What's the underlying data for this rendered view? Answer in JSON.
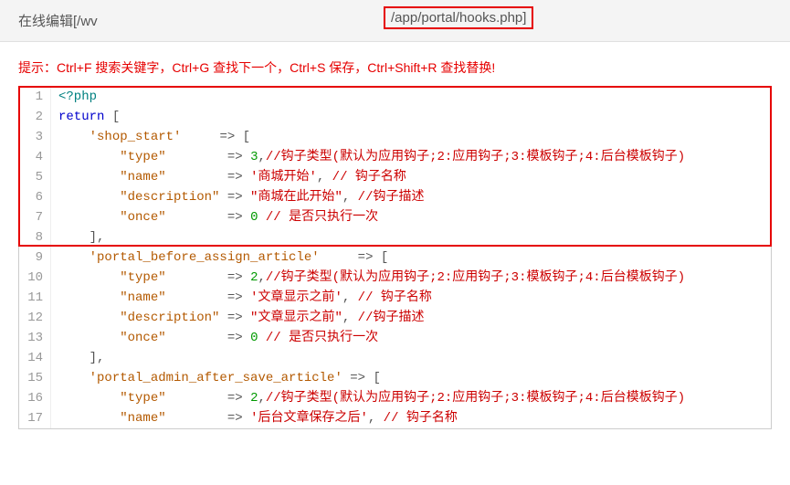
{
  "header": {
    "title_prefix": "在线编辑[/wv",
    "path_fragment": "/app/portal/hooks.php]"
  },
  "hint": "提示：Ctrl+F 搜索关键字，Ctrl+G 查找下一个，Ctrl+S 保存，Ctrl+Shift+R 查找替换!",
  "lines": {
    "l1_open": "<?php",
    "l2_return": "return",
    "l2_brkt": " [",
    "l3_key": "'shop_start'",
    "l3_arrow": "     => [",
    "l4_key": "\"type\"",
    "l4_arrow": "        => ",
    "l4_val": "3",
    "l4_com": ",",
    "l4_cmt1": "//钩子类型(默认为应用钩子;2:应用钩子;3:模板钩子;4:后台模板钩子)",
    "l5_key": "\"name\"",
    "l5_arrow": "        => ",
    "l5_val": "'商城开始'",
    "l5_com": ",",
    "l5_cmt": " // 钩子名称",
    "l6_key": "\"description\"",
    "l6_arrow": " => ",
    "l6_val": "\"商城在此开始\"",
    "l6_com": ",",
    "l6_cmt": " //钩子描述",
    "l7_key": "\"once\"",
    "l7_arrow": "        => ",
    "l7_val": "0",
    "l7_cmt": " // 是否只执行一次",
    "l8": "    ],",
    "l9_key": "'portal_before_assign_article'",
    "l9_arrow": "     => [",
    "l10_key": "\"type\"",
    "l10_arrow": "        => ",
    "l10_val": "2",
    "l10_com": ",",
    "l10_cmt1": "//钩子类型(默认为应用钩子;2:应用钩子;3:模板钩子;4:后台模板钩子)",
    "l11_key": "\"name\"",
    "l11_arrow": "        => ",
    "l11_val": "'文章显示之前'",
    "l11_com": ",",
    "l11_cmt": " // 钩子名称",
    "l12_key": "\"description\"",
    "l12_arrow": " => ",
    "l12_val": "\"文章显示之前\"",
    "l12_com": ",",
    "l12_cmt": " //钩子描述",
    "l13_key": "\"once\"",
    "l13_arrow": "        => ",
    "l13_val": "0",
    "l13_cmt": " // 是否只执行一次",
    "l14": "    ],",
    "l15_key": "'portal_admin_after_save_article'",
    "l15_arrow": " => [",
    "l16_key": "\"type\"",
    "l16_arrow": "        => ",
    "l16_val": "2",
    "l16_com": ",",
    "l16_cmt1": "//钩子类型(默认为应用钩子;2:应用钩子;3:模板钩子;4:后台模板钩子)",
    "l17_key": "\"name\"",
    "l17_arrow": "        => ",
    "l17_val": "'后台文章保存之后'",
    "l17_com": ",",
    "l17_cmt": " // 钩子名称"
  },
  "gutters": [
    "1",
    "2",
    "3",
    "4",
    "5",
    "6",
    "7",
    "8",
    "9",
    "10",
    "11",
    "12",
    "13",
    "14",
    "15",
    "16",
    "17"
  ]
}
